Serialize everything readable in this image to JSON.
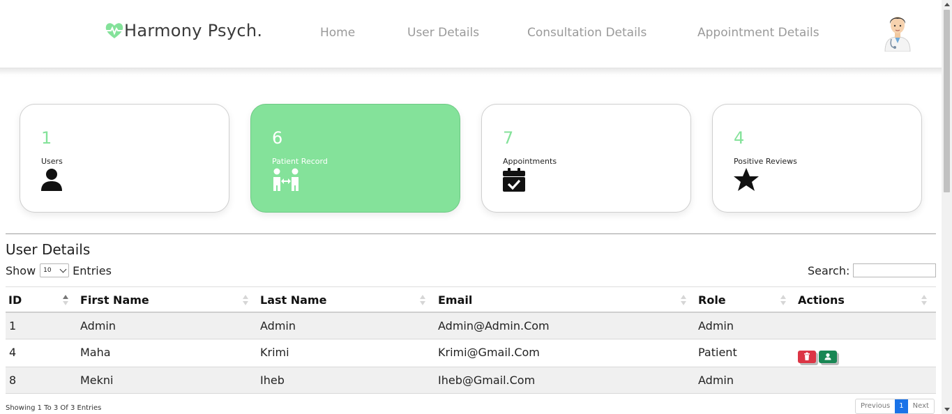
{
  "brand": {
    "name": "Harmony Psych.",
    "accent": "#84e29a"
  },
  "nav": {
    "home": "Home",
    "users": "User Details",
    "consultations": "Consultation Details",
    "appointments": "Appointment Details"
  },
  "cards": [
    {
      "value": "1",
      "label": "Users",
      "icon": "user-icon"
    },
    {
      "value": "6",
      "label": "Patient Record",
      "icon": "people-arrows-icon"
    },
    {
      "value": "7",
      "label": "Appointments",
      "icon": "calendar-check-icon"
    },
    {
      "value": "4",
      "label": "Positive Reviews",
      "icon": "star-icon"
    }
  ],
  "section": {
    "title": "User Details"
  },
  "controls": {
    "show_label": "Show",
    "page_size": "10",
    "entries_label": "Entries",
    "search_label": "Search:"
  },
  "table": {
    "headers": [
      "ID",
      "First Name",
      "Last Name",
      "Email",
      "Role",
      "Actions"
    ],
    "rows": [
      {
        "id": "1",
        "first": "Admin",
        "last": "Admin",
        "email": "Admin@Admin.Com",
        "role": "Admin"
      },
      {
        "id": "4",
        "first": "Maha",
        "last": "Krimi",
        "email": "Krimi@Gmail.Com",
        "role": "Patient"
      },
      {
        "id": "8",
        "first": "Mekni",
        "last": "Iheb",
        "email": "Iheb@Gmail.Com",
        "role": "Admin"
      }
    ]
  },
  "footer": {
    "info": "Showing 1 To 3 Of 3 Entries",
    "prev": "Previous",
    "page": "1",
    "next": "Next"
  }
}
